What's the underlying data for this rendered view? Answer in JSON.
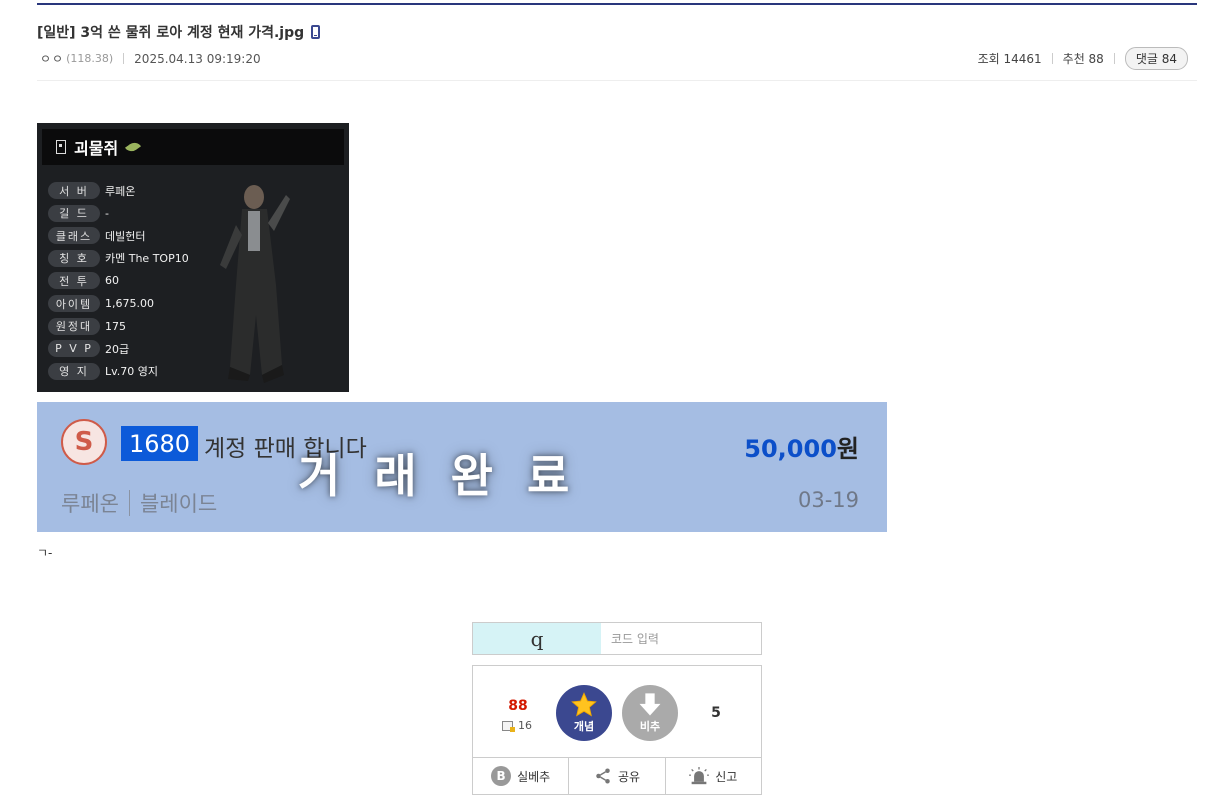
{
  "post": {
    "title": "[일반] 3억 쓴 물쥐 로아 계정 현재 가격.jpg",
    "author_nick": "ㅇㅇ",
    "author_ip": "(118.38)",
    "datetime": "2025.04.13 09:19:20",
    "views_label": "조회 14461",
    "recommend_label": "추천 88",
    "comment_label": "댓글 84",
    "body_text": "ㄱ-"
  },
  "character_card": {
    "name": "괴물쥐",
    "stats": [
      {
        "label": "서 버",
        "value": "루페온"
      },
      {
        "label": "길 드",
        "value": "-"
      },
      {
        "label": "클래스",
        "value": "데빌헌터"
      },
      {
        "label": "칭 호",
        "value": "카멘 The TOP10"
      },
      {
        "label": "전 투",
        "value": "60"
      },
      {
        "label": "아이템",
        "value": "1,675.00"
      },
      {
        "label": "원정대",
        "value": "175"
      },
      {
        "label": "P V P",
        "value": "20급"
      },
      {
        "label": "영 지",
        "value": "Lv.70 영지"
      }
    ]
  },
  "sale_banner": {
    "logo_letter": "S",
    "level": "1680",
    "title": "계정 판매 합니다",
    "price": "50,000",
    "price_unit": "원",
    "server": "루페온",
    "class_name": "블레이드",
    "date": "03-19",
    "stamp": "거래완료"
  },
  "captcha": {
    "image_text": "q",
    "placeholder": "코드 입력"
  },
  "vote": {
    "up_count": "88",
    "fix_count": "16",
    "up_label": "개념",
    "down_label": "비추",
    "down_count": "5",
    "actions": [
      {
        "label": "실베추",
        "icon_text": "B"
      },
      {
        "label": "공유"
      },
      {
        "label": "신고"
      }
    ]
  },
  "colors": {
    "accent": "#3b4890",
    "recommend_red": "#d31900",
    "banner_bg": "#a5bde3",
    "banner_blue": "#0c5ad9"
  },
  "icons": [
    "mobile-icon",
    "bookmark-icon",
    "leaf-icon",
    "star-icon",
    "arrow-down-icon",
    "share-icon",
    "siren-icon"
  ]
}
